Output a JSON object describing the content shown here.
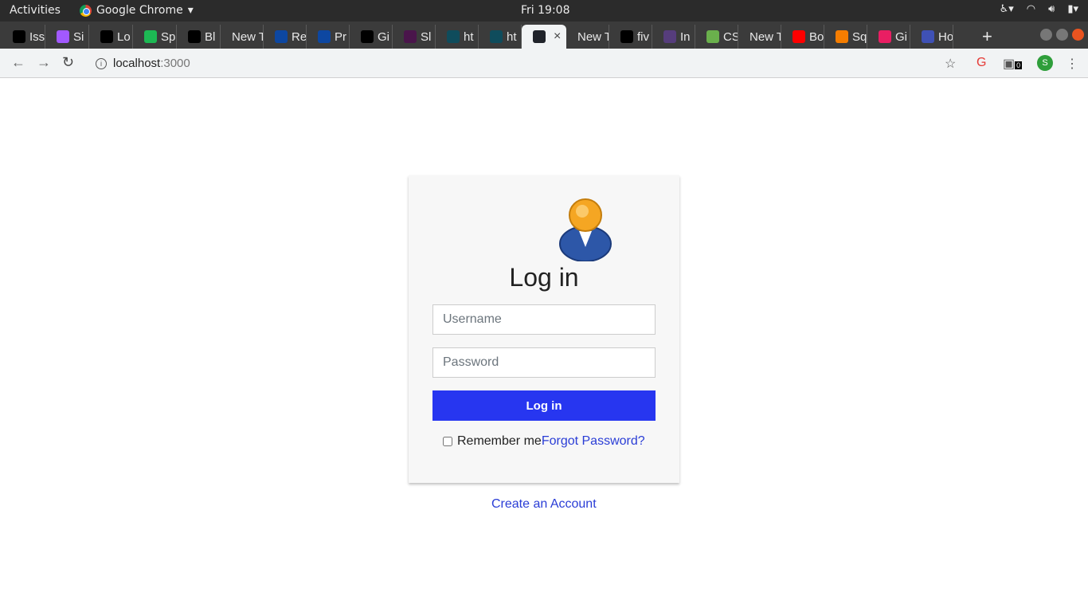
{
  "topbar": {
    "activities": "Activities",
    "app_name": "Google Chrome",
    "clock": "Fri 19:08"
  },
  "tabs": [
    {
      "label": "Iss",
      "icon": "github-icon",
      "color": "#000000"
    },
    {
      "label": "Si",
      "icon": "figma-icon",
      "color": "#a259ff"
    },
    {
      "label": "Lo",
      "icon": "github-icon",
      "color": "#000000"
    },
    {
      "label": "Sp",
      "icon": "spotify-icon",
      "color": "#1db954"
    },
    {
      "label": "Bl",
      "icon": "github-icon",
      "color": "#000000"
    },
    {
      "label": "New T",
      "icon": "none",
      "color": "#3b3b3b"
    },
    {
      "label": "Re",
      "icon": "md-icon",
      "color": "#0d47a1"
    },
    {
      "label": "Pr",
      "icon": "md-icon",
      "color": "#0d47a1"
    },
    {
      "label": "Gi",
      "icon": "github-icon",
      "color": "#000000"
    },
    {
      "label": "Sl",
      "icon": "slack-icon",
      "color": "#4a154b"
    },
    {
      "label": "ht",
      "icon": "css-icon",
      "color": "#0f4c5c"
    },
    {
      "label": "ht",
      "icon": "css-icon",
      "color": "#0f4c5c"
    },
    {
      "label": "",
      "icon": "react-icon",
      "color": "#20232a",
      "active": true
    },
    {
      "label": "New T",
      "icon": "none",
      "color": "#3b3b3b"
    },
    {
      "label": "fiv",
      "icon": "fiverr-icon",
      "color": "#000000"
    },
    {
      "label": "In",
      "icon": "bootstrap-icon",
      "color": "#563d7c"
    },
    {
      "label": "CS",
      "icon": "chart-icon",
      "color": "#6ab04c"
    },
    {
      "label": "New T",
      "icon": "none",
      "color": "#3b3b3b"
    },
    {
      "label": "Bo",
      "icon": "youtube-icon",
      "color": "#ff0000"
    },
    {
      "label": "Sq",
      "icon": "blogger-icon",
      "color": "#f57d00"
    },
    {
      "label": "Gi",
      "icon": "giphy-icon",
      "color": "#e91e63"
    },
    {
      "label": "Ho",
      "icon": "calendar-icon",
      "color": "#3f51b5"
    }
  ],
  "toolbar": {
    "url_host": "localhost",
    "url_port": ":3000",
    "extension_badge": "0",
    "profile_initial": "S"
  },
  "login": {
    "title": "Log in",
    "username_placeholder": "Username",
    "password_placeholder": "Password",
    "submit_label": "Log in",
    "remember_label": "Remember me",
    "forgot_label": "Forgot Password?",
    "create_account_label": "Create an Account"
  },
  "colors": {
    "accent": "#2736f0",
    "link": "#2a3dd6"
  }
}
